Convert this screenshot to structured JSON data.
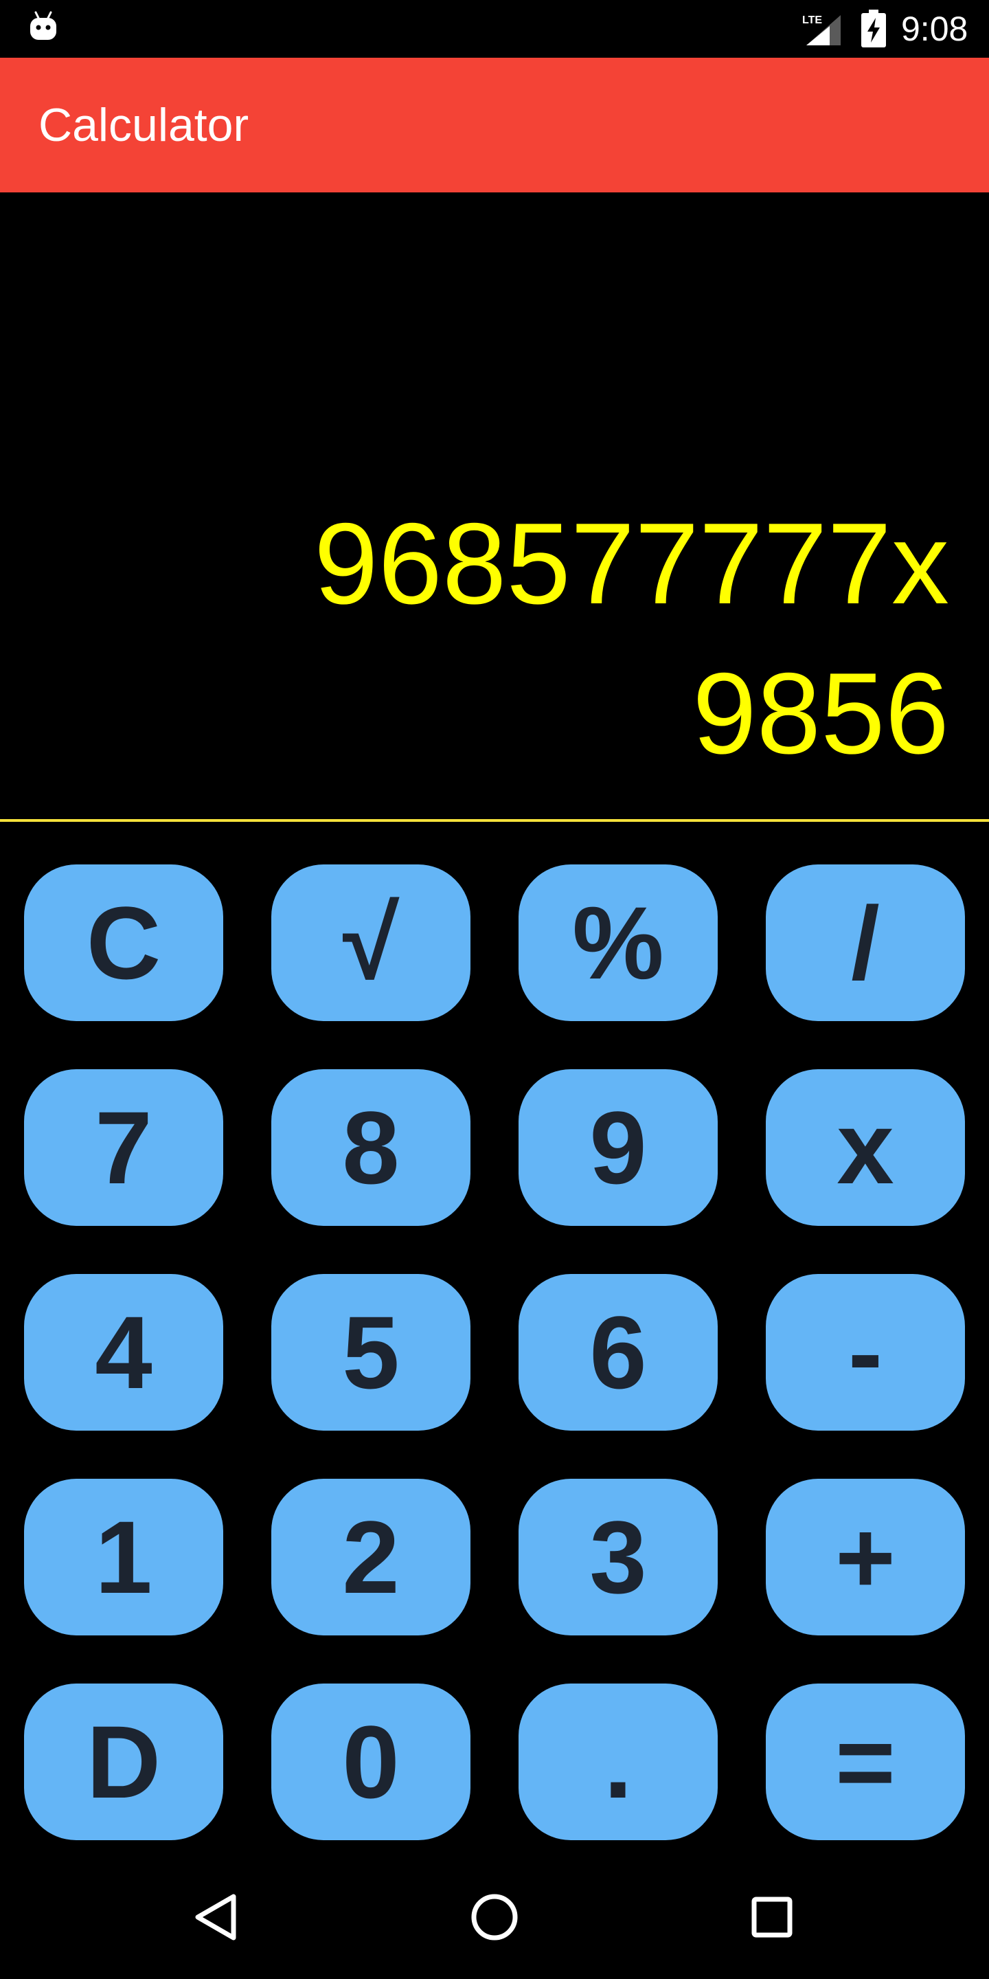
{
  "status_bar": {
    "network": "LTE",
    "time": "9:08",
    "icons": [
      "android-icon",
      "lte-signal-icon",
      "battery-charging-icon"
    ]
  },
  "app_bar": {
    "title": "Calculator",
    "color": "#f44336"
  },
  "display": {
    "expression_line": "968577777x",
    "operand_line": "9856",
    "text_color": "#ffff00"
  },
  "keypad": {
    "key_color": "#64b5f6",
    "rows": [
      [
        "C",
        "√",
        "%",
        "/"
      ],
      [
        "7",
        "8",
        "9",
        "x"
      ],
      [
        "4",
        "5",
        "6",
        "-"
      ],
      [
        "1",
        "2",
        "3",
        "+"
      ],
      [
        "D",
        "0",
        ".",
        "="
      ]
    ]
  },
  "nav_bar": {
    "icons": [
      "back-icon",
      "home-icon",
      "recents-icon"
    ]
  }
}
